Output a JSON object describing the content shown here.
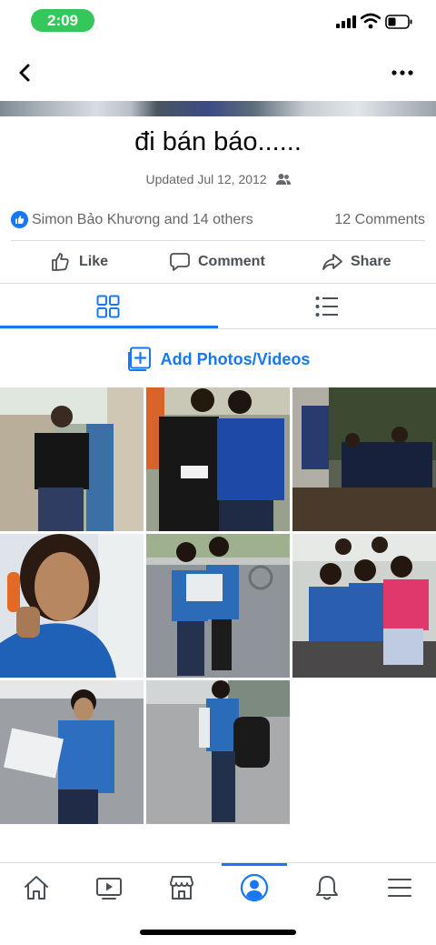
{
  "status_bar": {
    "time": "2:09"
  },
  "nav": {
    "back_icon": "chevron-left-icon",
    "more_icon": "more-dots-icon"
  },
  "album": {
    "title": "đi bán báo......",
    "updated": "Updated Jul 12, 2012",
    "privacy_icon": "friends-icon"
  },
  "reactions": {
    "reactors": "Simon Bảo Khương and 14 others",
    "comments": "12 Comments"
  },
  "actions": [
    {
      "label": "Like",
      "icon": "thumbs-up-icon"
    },
    {
      "label": "Comment",
      "icon": "comment-icon"
    },
    {
      "label": "Share",
      "icon": "share-icon"
    }
  ],
  "tabs": [
    {
      "icon": "grid-view-icon",
      "selected": true
    },
    {
      "icon": "list-view-icon",
      "selected": false
    }
  ],
  "add_photos": {
    "label": "Add Photos/Videos",
    "icon": "add-photo-icon"
  },
  "photos_count": 8,
  "bottom_nav": [
    {
      "icon": "home-icon",
      "selected": false
    },
    {
      "icon": "watch-icon",
      "selected": false
    },
    {
      "icon": "marketplace-icon",
      "selected": false
    },
    {
      "icon": "profile-icon",
      "selected": true
    },
    {
      "icon": "bell-icon",
      "selected": false
    },
    {
      "icon": "menu-icon",
      "selected": false
    }
  ],
  "colors": {
    "accent": "#1877f2",
    "time_pill": "#34c759",
    "secondary_text": "#65676b"
  }
}
